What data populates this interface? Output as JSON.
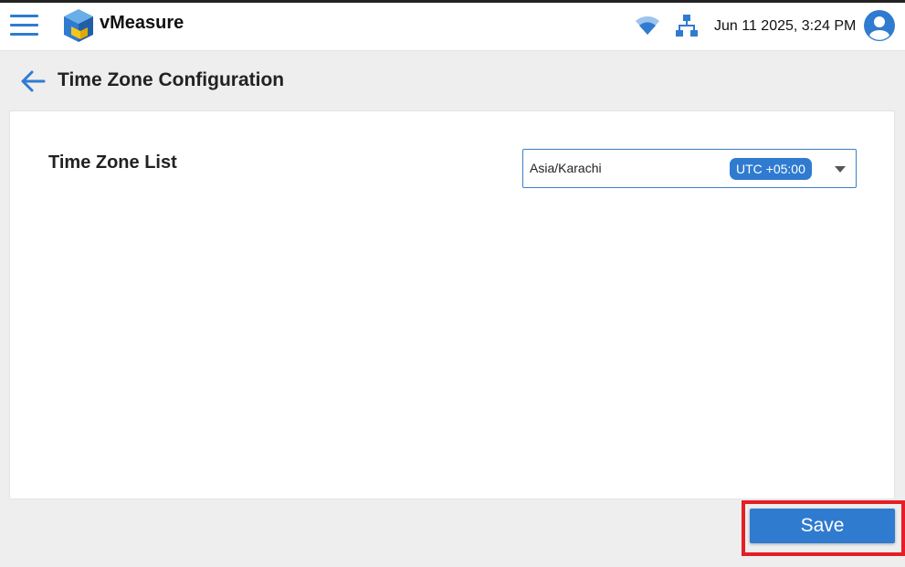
{
  "header": {
    "brand": "vMeasure",
    "datetime": "Jun 11 2025, 3:24 PM",
    "icons": {
      "menu": "hamburger-menu-icon",
      "logo": "vmeasure-logo-icon",
      "wifi": "wifi-icon",
      "network": "network-icon",
      "user": "user-avatar-icon"
    }
  },
  "page": {
    "title": "Time Zone Configuration",
    "back_icon": "arrow-left-icon"
  },
  "timezone": {
    "label": "Time Zone List",
    "selected": "Asia/Karachi",
    "offset": "UTC +05:00",
    "caret_icon": "caret-down-icon"
  },
  "actions": {
    "save_label": "Save"
  },
  "colors": {
    "accent": "#2f7bd0",
    "highlight": "#e41e25",
    "background": "#eeeeee"
  }
}
